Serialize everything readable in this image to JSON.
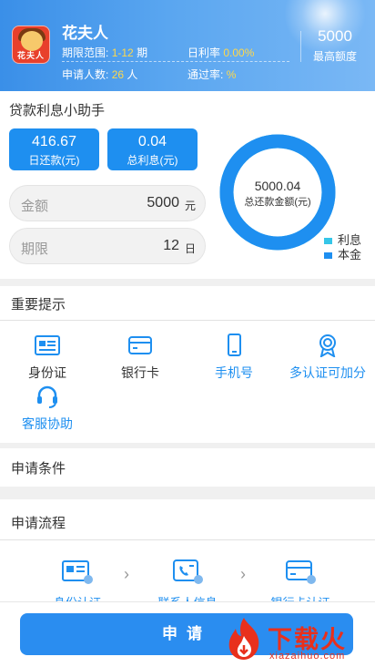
{
  "header": {
    "app_name": "花夫人",
    "logo_text": "花夫人",
    "term_label": "期限范围:",
    "term_value": "1-12",
    "term_unit": "期",
    "rate_label": "日利率",
    "rate_value": "0.00%",
    "applicants_label": "申请人数:",
    "applicants_value": "26",
    "applicants_unit": "人",
    "pass_label": "通过率:",
    "pass_value": "%",
    "max_amount": "5000",
    "max_amount_label": "最高额度"
  },
  "calculator": {
    "title": "贷款利息小助手",
    "daily_repay_value": "416.67",
    "daily_repay_label": "日还款(元)",
    "total_interest_value": "0.04",
    "total_interest_label": "总利息(元)",
    "amount_label": "金额",
    "amount_value": "5000",
    "amount_unit": "元",
    "term_label": "期限",
    "term_value": "12",
    "term_unit": "日",
    "donut_total": "5000.04",
    "donut_label": "总还款金额(元)",
    "legend_interest": "利息",
    "legend_principal": "本金",
    "interest_color": "#35c6e8",
    "principal_color": "#1e8ff0",
    "principal_share": 0.99999
  },
  "notice": {
    "title": "重要提示",
    "items": [
      {
        "label": "身份证",
        "icon": "id-card-icon"
      },
      {
        "label": "银行卡",
        "icon": "bank-card-icon"
      },
      {
        "label": "手机号",
        "icon": "phone-icon"
      },
      {
        "label": "多认证可加分",
        "icon": "badge-icon"
      },
      {
        "label": "客服协助",
        "icon": "headset-icon"
      }
    ]
  },
  "conditions": {
    "title": "申请条件"
  },
  "process": {
    "title": "申请流程",
    "steps": [
      {
        "label": "身份认证",
        "icon": "id-verify-icon"
      },
      {
        "label": "联系人信息",
        "icon": "contact-icon"
      },
      {
        "label": "银行卡认证",
        "icon": "bank-verify-icon"
      }
    ]
  },
  "footer": {
    "apply_label": "申请",
    "watermark_text": "下载火",
    "watermark_url": "xiazaihuo.com"
  },
  "colors": {
    "accent": "#1e8ff0",
    "header_start": "#3a8fe8",
    "highlight": "#ffd84a"
  }
}
